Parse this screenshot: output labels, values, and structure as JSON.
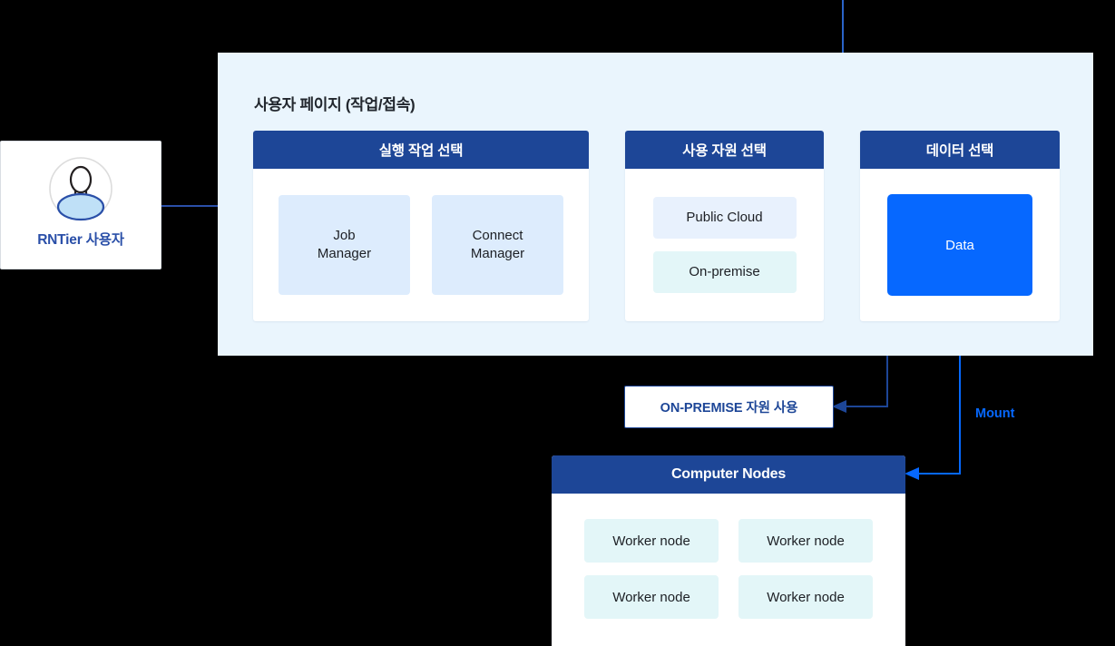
{
  "user": {
    "label": "RNTier 사용자",
    "avatar_icon": "user-avatar-icon"
  },
  "panel": {
    "title": "사용자 페이지 (작업/접속)",
    "cards": [
      {
        "header": "실행 작업 선택",
        "tiles": [
          {
            "line1": "Job",
            "line2": "Manager"
          },
          {
            "line1": "Connect",
            "line2": "Manager"
          }
        ]
      },
      {
        "header": "사용 자원 선택",
        "tiles": [
          {
            "label": "Public Cloud"
          },
          {
            "label": "On-premise"
          }
        ]
      },
      {
        "header": "데이터 선택",
        "tiles": [
          {
            "label": "Data"
          }
        ]
      }
    ]
  },
  "callouts": {
    "onpremise": "ON-PREMISE 자원 사용",
    "mount": "Mount"
  },
  "nodes": {
    "header": "Computer Nodes",
    "items": [
      {
        "label": "Worker node"
      },
      {
        "label": "Worker node"
      },
      {
        "label": "Worker node"
      },
      {
        "label": "Worker node"
      }
    ]
  },
  "colors": {
    "panel_bg": "#eaf5fd",
    "header_navy": "#1d4697",
    "accent_blue": "#0668ff",
    "tile_blue": "#ddecfd",
    "tile_blue_light": "#e8f1fd",
    "tile_cyan": "#e3f6f8",
    "canvas": "#000000",
    "user_label": "#2a4fa8"
  }
}
